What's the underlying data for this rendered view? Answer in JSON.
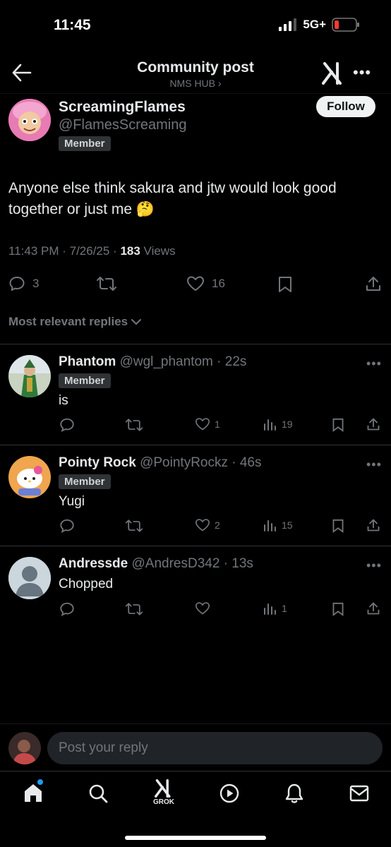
{
  "status_bar": {
    "time": "11:45",
    "network": "5G+"
  },
  "header": {
    "title": "Community post",
    "subtitle": "NMS HUB ›"
  },
  "post": {
    "author_name": "ScreamingFlames",
    "author_handle": "@FlamesScreaming",
    "badge": "Member",
    "follow_label": "Follow",
    "text": "Anyone else think sakura and jtw would look good together or just me 🤔",
    "timestamp": "11:43 PM · 7/26/25 · ",
    "views_count": "183",
    "views_label": " Views",
    "reply_count": "3",
    "like_count": "16"
  },
  "replies_sort_label": "Most relevant replies",
  "replies": [
    {
      "name": "Phantom",
      "handle": "@wgl_phantom · 22s",
      "badge": "Member",
      "text": "is",
      "likes": "1",
      "views": "19"
    },
    {
      "name": "Pointy Rock",
      "handle": "@PointyRockz · 46s",
      "badge": "Member",
      "text": "Yugi",
      "likes": "2",
      "views": "15"
    },
    {
      "name": "Andressde",
      "handle": "@AndresD342 · 13s",
      "text": "Chopped",
      "views": "1"
    }
  ],
  "compose": {
    "placeholder": "Post your reply"
  },
  "nav": {
    "grok_label": "GROK"
  },
  "colors": {
    "background": "#000000",
    "text": "#e7e9ea",
    "muted": "#71767b",
    "notification_dot": "#1d9bf0"
  }
}
